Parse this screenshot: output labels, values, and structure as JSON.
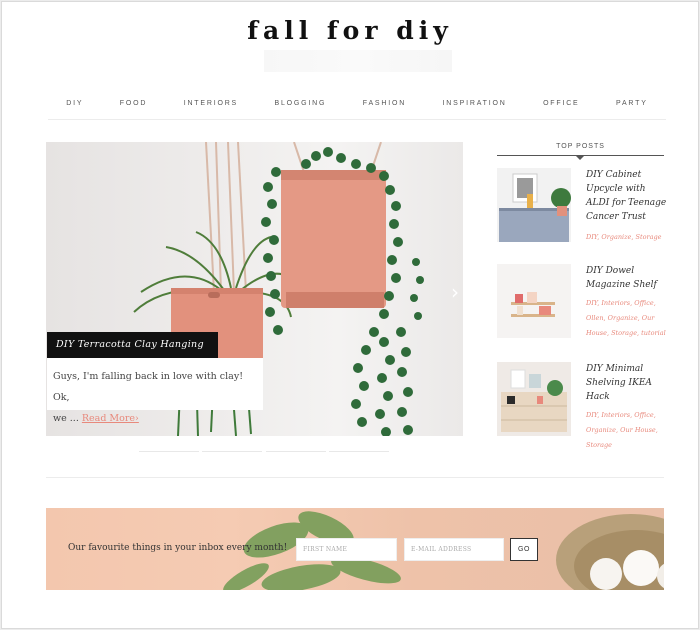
{
  "site": {
    "logo": "fall for diy"
  },
  "nav": {
    "items": [
      "DIY",
      "FOOD",
      "INTERIORS",
      "BLOGGING",
      "FASHION",
      "INSPIRATION",
      "OFFICE",
      "PARTY"
    ]
  },
  "hero": {
    "title": "DIY Terracotta Clay Hanging Planters",
    "excerpt_line1": "Guys, I'm falling back in love with clay! Ok,",
    "excerpt_line2": "we ...",
    "read_more": "Read More",
    "next_icon": "chevron-right-icon"
  },
  "sidebar": {
    "heading": "TOP POSTS",
    "posts": [
      {
        "title": "DIY Cabinet Upcycle with ALDI for Teenage Cancer Trust",
        "tags": "DIY, Organize, Storage"
      },
      {
        "title": "DIY Dowel Magazine Shelf",
        "tags": "DIY, Interiors, Office, Ollen, Organize, Our House, Storage, tutorial"
      },
      {
        "title": "DIY Minimal Shelving IKEA Hack",
        "tags": "DIY, Interiors, Office, Organize, Our House, Storage"
      }
    ]
  },
  "newsletter": {
    "text": "Our favourite things in your inbox every month!",
    "first_name_placeholder": "FIRST NAME",
    "email_placeholder": "E-MAIL ADDRESS",
    "submit_label": "GO"
  },
  "colors": {
    "accent": "#e8897c",
    "terracotta": "#e2917d",
    "foliage": "#2f6b3a"
  }
}
